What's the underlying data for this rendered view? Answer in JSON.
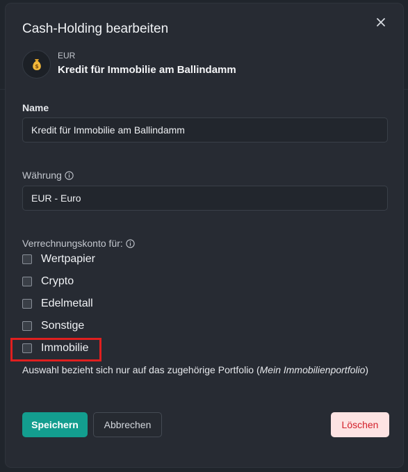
{
  "dialog": {
    "title": "Cash-Holding bearbeiten",
    "close_icon": "close-icon"
  },
  "holding": {
    "icon": "money-bag-icon",
    "currency": "EUR",
    "name": "Kredit für Immobilie am Ballindamm"
  },
  "fields": {
    "name_label": "Name",
    "name_value": "Kredit für Immobilie am Ballindamm",
    "currency_label": "Währung",
    "currency_value": "EUR - Euro",
    "clearing_label": "Verrechnungskonto für:"
  },
  "checkboxes": [
    {
      "label": "Wertpapier",
      "checked": false
    },
    {
      "label": "Crypto",
      "checked": false
    },
    {
      "label": "Edelmetall",
      "checked": false
    },
    {
      "label": "Sonstige",
      "checked": false
    },
    {
      "label": "Immobilie",
      "checked": false
    }
  ],
  "note": {
    "text": "Auswahl bezieht sich nur auf das zugehörige Portfolio (",
    "portfolio": "Mein Immobilienportfolio",
    "close_paren": ")"
  },
  "buttons": {
    "save": "Speichern",
    "cancel": "Abbrechen",
    "delete": "Löschen"
  },
  "colors": {
    "accent": "#139e8f",
    "danger": "#d21f2a",
    "highlight": "#e01f1f"
  }
}
